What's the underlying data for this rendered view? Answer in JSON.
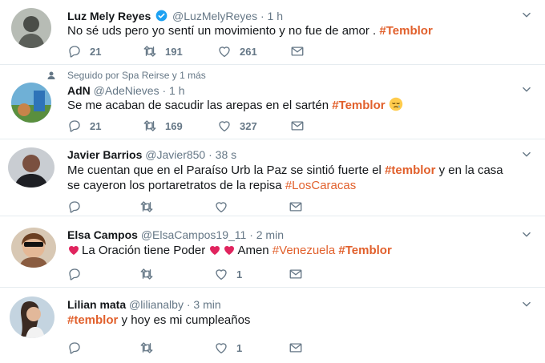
{
  "tweets": [
    {
      "name": "Luz Mely Reyes",
      "handle": "@LuzMelyReyes",
      "time": "1 h",
      "verified": true,
      "text": "No sé uds pero yo sentí un movimiento y no fue de amor .",
      "hashtag": "#Temblor",
      "replies": "21",
      "retweets": "191",
      "likes": "261"
    },
    {
      "context": "Seguido por Spa Reirse y 1 más",
      "name": "AdN",
      "handle": "@AdeNieves",
      "time": "1 h",
      "text": "Se me acaban de sacudir las arepas en el sartén",
      "hashtag": "#Temblor",
      "replies": "21",
      "retweets": "169",
      "likes": "327"
    },
    {
      "name": "Javier Barrios",
      "handle": "@Javier850",
      "time": "38 s",
      "text_line1": "Me cuentan que en el Paraíso  Urb la Paz  se sintió fuerte el",
      "hashtag1": "#temblor",
      "text_line1b": "y en la casa",
      "text_line2": "se cayeron los portaretratos de la repisa",
      "hashtag2": "#LosCaracas"
    },
    {
      "name": "Elsa Campos",
      "handle": "@ElsaCampos19_11",
      "time": "2 min",
      "text": "La Oración tiene Poder",
      "text_mid": "Amen",
      "hashtag1": "#Venezuela",
      "hashtag2": "#Temblor",
      "likes": "1"
    },
    {
      "name": "Lilian mata",
      "handle": "@lilianalby",
      "time": "3 min",
      "hashtag": "#temblor",
      "text": "y hoy es mi cumpleaños",
      "likes": "1"
    }
  ],
  "dot": "·",
  "icons": {
    "reply": "reply-icon",
    "retweet": "retweet-icon",
    "like": "heart-icon",
    "message": "envelope-icon",
    "caret": "chevron-down-icon",
    "verified": "verified-badge-icon",
    "follow": "person-icon"
  },
  "colors": {
    "hashtag": "#e1602c",
    "muted": "#657786",
    "verified": "#1da1f2",
    "heart_emoji": "#e0245e"
  }
}
